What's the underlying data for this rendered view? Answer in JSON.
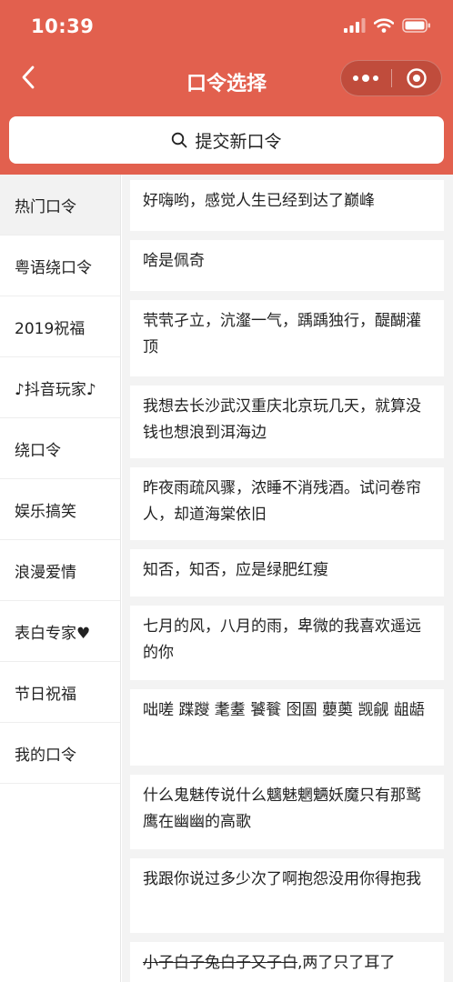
{
  "status_bar": {
    "time": "10:39"
  },
  "nav": {
    "title": "口令选择"
  },
  "submit": {
    "label": "提交新口令"
  },
  "sidebar": {
    "items": [
      {
        "label": "热门口令",
        "active": true
      },
      {
        "label": "粤语绕口令"
      },
      {
        "label": "2019祝福"
      },
      {
        "label": "♪抖音玩家♪"
      },
      {
        "label": "绕口令"
      },
      {
        "label": "娱乐搞笑"
      },
      {
        "label": "浪漫爱情"
      },
      {
        "label": "表白专家♥"
      },
      {
        "label": "节日祝福"
      },
      {
        "label": "我的口令"
      }
    ]
  },
  "phrases": [
    "好嗨哟，感觉人生已经到达了巅峰",
    "啥是佩奇",
    "茕茕孑立，沆瀣一气，踽踽独行，醍醐灌顶",
    "我想去长沙武汉重庆北京玩几天，就算没钱也想浪到洱海边",
    "昨夜雨疏风骤，浓睡不消残酒。试问卷帘人，却道海棠依旧",
    "知否，知否，应是绿肥红瘦",
    "七月的风，八月的雨，卑微的我喜欢遥远的你",
    "咄嗟 蹀躞 耄耋 饕餮 囹圄 蘡薁 觊觎 龃龉",
    "什么鬼魅传说什么魑魅魍魉妖魔只有那鹫鹰在幽幽的高歌",
    "我跟你说过多少次了啊抱怨没用你得抱我"
  ],
  "last_phrase": {
    "struck": "小子白子兔白子又子白",
    "rest": ",两了只了耳了"
  },
  "icons": {
    "back": "chevron-left-icon",
    "more": "more-dots-icon",
    "close": "target-circle-icon",
    "search": "search-icon",
    "signal": "signal-icon",
    "wifi": "wifi-icon",
    "battery": "battery-icon"
  },
  "colors": {
    "header_bg": "#e2604e",
    "content_bg": "#f3f3f3",
    "active_item_bg": "#f2f2f2"
  }
}
